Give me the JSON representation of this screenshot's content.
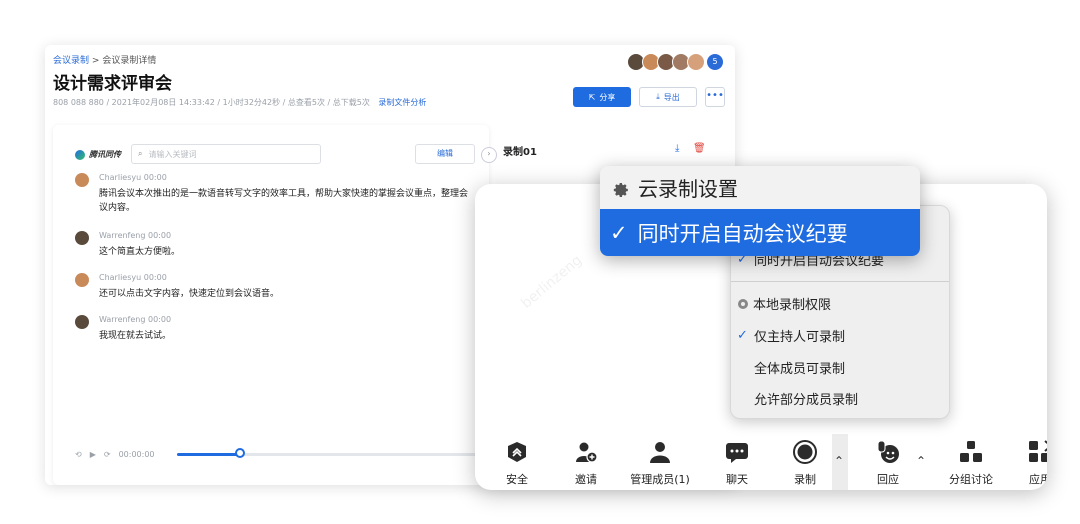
{
  "back": {
    "breadcrumb_link": "会议录制",
    "breadcrumb_sep": ">",
    "breadcrumb_current": "会议录制详情",
    "title": "设计需求评审会",
    "meta": "808 088 880 / 2021年02月08日 14:33:42 / 1小时32分42秒 / 总查看5次 / 总下载5次",
    "meta_link": "录制文件分析",
    "avatar_count": "5",
    "share_label": "分享",
    "export_label": "导出",
    "more_label": "•••",
    "logo_text": "腾讯同传",
    "search_placeholder": "请输入关键词",
    "edit_label": "编辑",
    "recording_name": "录制01",
    "time": "00:00:00",
    "transcript": [
      {
        "speaker": "Charliesyu 00:00",
        "text": "腾讯会议本次推出的是一款语音转写文字的效率工具，帮助大家快速的掌握会议重点，整理会议内容。"
      },
      {
        "speaker": "Warrenfeng 00:00",
        "text": "这个简直太方便啦。"
      },
      {
        "speaker": "Charliesyu 00:00",
        "text": "还可以点击文字内容，快速定位到会议语音。"
      },
      {
        "speaker": "Warrenfeng 00:00",
        "text": "我现在就去试试。"
      }
    ]
  },
  "front": {
    "watermark": "berlinzeng",
    "toolbar": [
      {
        "label": "安全",
        "icon": "shield-icon"
      },
      {
        "label": "邀请",
        "icon": "invite-user-icon"
      },
      {
        "label": "管理成员(1)",
        "icon": "members-icon"
      },
      {
        "label": "聊天",
        "icon": "chat-icon"
      },
      {
        "label": "录制",
        "icon": "record-icon"
      },
      {
        "label": "回应",
        "icon": "reaction-icon"
      },
      {
        "label": "分组讨论",
        "icon": "breakout-icon"
      },
      {
        "label": "应用",
        "icon": "apps-icon"
      }
    ],
    "menu": {
      "cloud_auto_summary": "同时开启自动会议纪要",
      "local_header": "本地录制权限",
      "host_only": "仅主持人可录制",
      "all_members": "全体成员可录制",
      "allow_some": "允许部分成员录制"
    }
  },
  "zoom": {
    "header": "云录制设置",
    "selected": "同时开启自动会议纪要"
  },
  "colors": {
    "accent": "#1f6be0",
    "danger": "#e0463e"
  }
}
